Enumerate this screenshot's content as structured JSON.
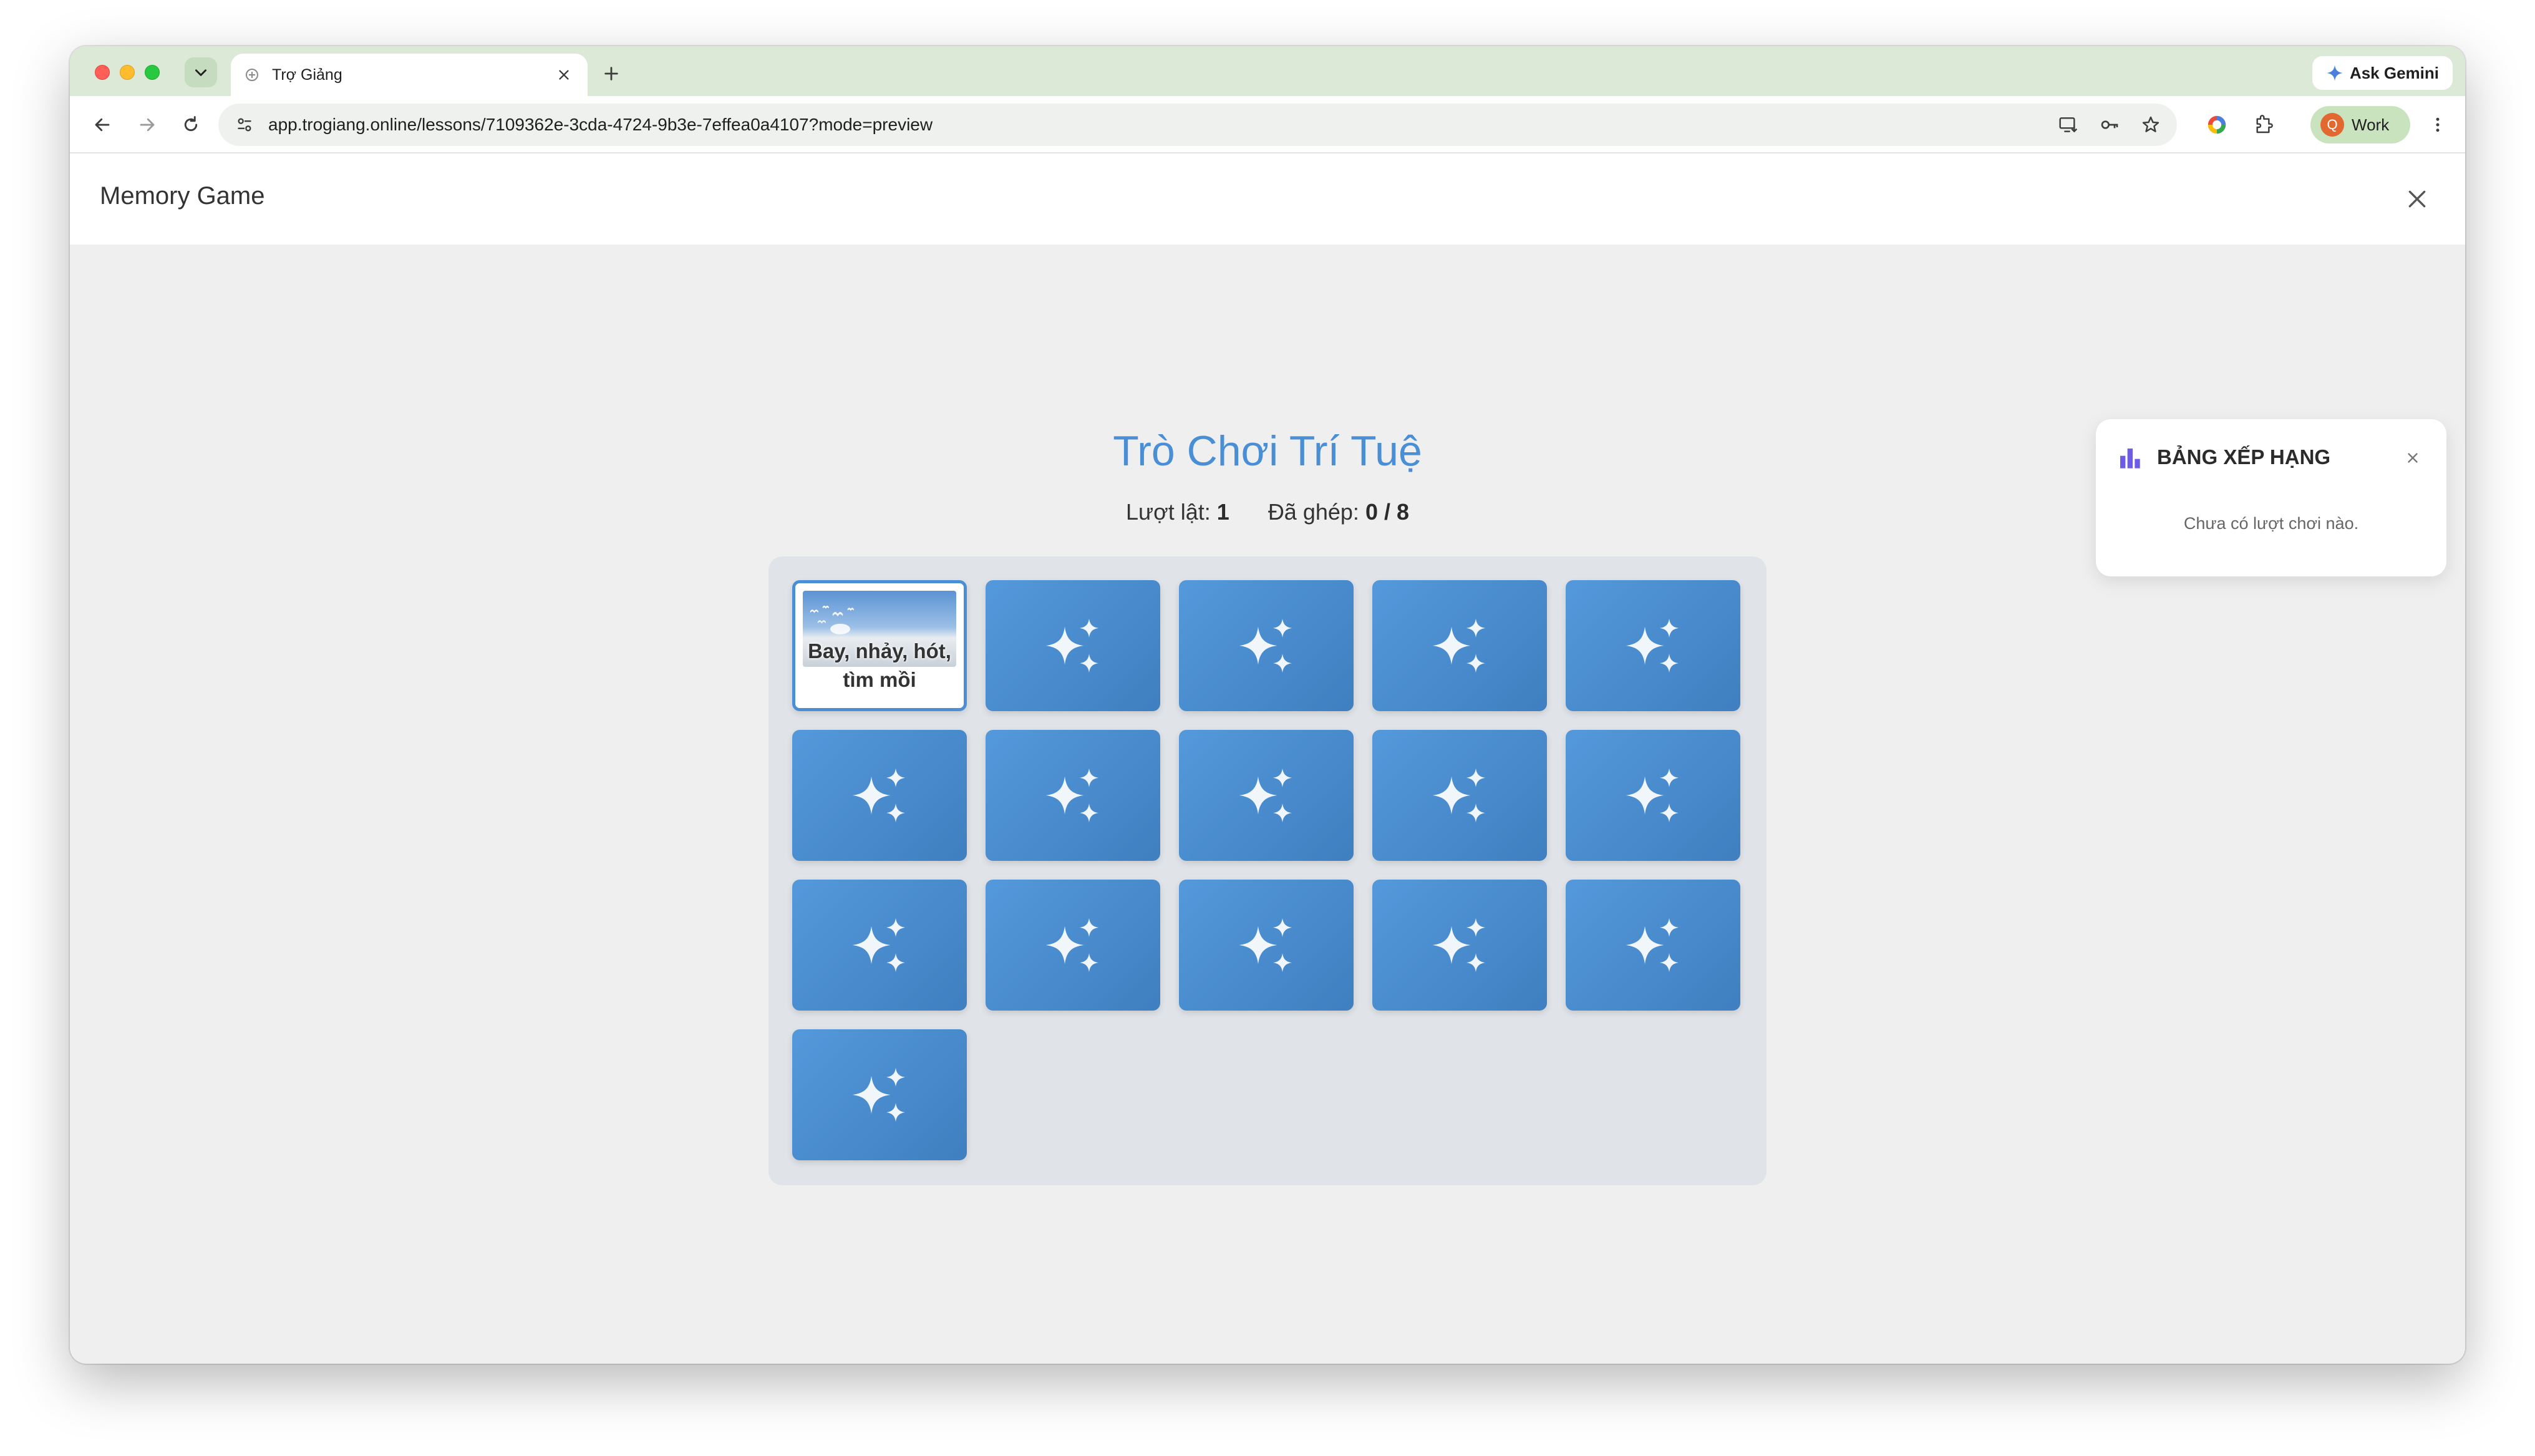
{
  "browser": {
    "tab": {
      "title": "Trợ Giảng"
    },
    "gemini_label": "Ask Gemini",
    "url": "app.trogiang.online/lessons/7109362e-3cda-4724-9b3e-7effea0a4107?mode=preview",
    "profile": {
      "initial": "Q",
      "label": "Work"
    }
  },
  "page": {
    "header_title": "Memory Game"
  },
  "game": {
    "title": "Trò Chơi Trí Tuệ",
    "stats": {
      "flips_label": "Lượt lật:",
      "flips_value": "1",
      "matched_label": "Đã ghép:",
      "matched_value": "0 / 8"
    },
    "flipped_card_text": "Bay, nhảy, hót, tìm mồi"
  },
  "leaderboard": {
    "title": "BẢNG XẾP HẠNG",
    "empty_text": "Chưa có lượt chơi nào."
  },
  "colors": {
    "card_blue": "#4a8fd6",
    "title_blue": "#4a8fd6",
    "leaderboard_icon": "#6c5ce7"
  }
}
